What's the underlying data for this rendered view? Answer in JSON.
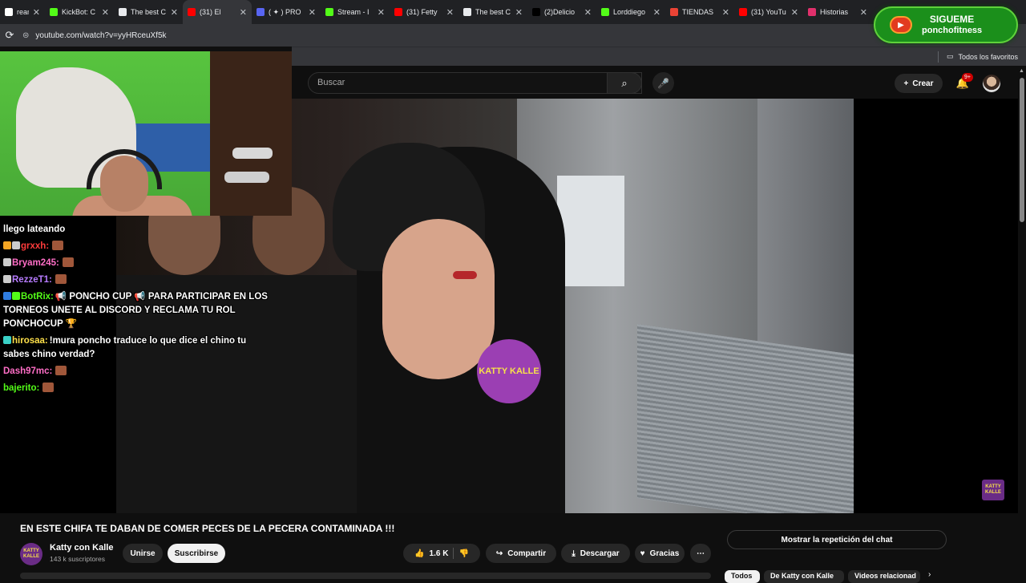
{
  "browser": {
    "tabs": [
      {
        "label": "ream - I",
        "color": "#ffffff",
        "active": false
      },
      {
        "label": "KickBot: C",
        "color": "#53fc18",
        "active": false
      },
      {
        "label": "The best C",
        "color": "#e8eaed",
        "active": false
      },
      {
        "label": "(31) El",
        "color": "#ff0000",
        "active": true
      },
      {
        "label": "( ✦ ) PRO",
        "color": "#5865f2",
        "active": false
      },
      {
        "label": "Stream - I",
        "color": "#53fc18",
        "active": false
      },
      {
        "label": "(31) Fetty",
        "color": "#ff0000",
        "active": false
      },
      {
        "label": "The best C",
        "color": "#e8eaed",
        "active": false
      },
      {
        "label": "(2)Delicio",
        "color": "#000000",
        "active": false
      },
      {
        "label": "Lorddiego",
        "color": "#53fc18",
        "active": false
      },
      {
        "label": "TIENDAS",
        "color": "#ea4335",
        "active": false
      },
      {
        "label": "(31) YouTu",
        "color": "#ff0000",
        "active": false
      },
      {
        "label": "Historias",
        "color": "#e1306c",
        "active": false
      }
    ],
    "close_glyph": "✕",
    "url": "youtube.com/watch?v=yyHRceuXf5k",
    "bookmarks_label": "Todos los favoritos"
  },
  "overlay": {
    "sigueme_line1": "SIGUEME",
    "sigueme_line2": "ponchofitness"
  },
  "youtube": {
    "search_placeholder": "Buscar",
    "crear_label": "Crear",
    "notif_badge": "9+",
    "video_title": "EN ESTE CHIFA TE DABAN DE COMER PECES DE LA PECERA CONTAMINADA !!!",
    "channel_name": "Katty con Kalle",
    "channel_subs": "143 k suscriptores",
    "unirse_label": "Unirse",
    "subscribe_label": "Suscribirse",
    "likes": "1.6 K",
    "share_label": "Compartir",
    "download_label": "Descargar",
    "thanks_label": "Gracias",
    "chat_replay_label": "Mostrar la repetición del chat",
    "chips": [
      "Todos",
      "De Katty con Kalle",
      "Videos relacionad"
    ],
    "logo_text": "KATTY KALLE",
    "mic_text": "KATTY KALLE"
  },
  "chat": [
    {
      "user": "",
      "user_color": "#ffffff",
      "text": "llego lateando",
      "badge_colors": []
    },
    {
      "user": "grxxh:",
      "user_color": "#ff3b3b",
      "text": "",
      "badge_colors": [
        "#f5a623",
        "#cccccc"
      ]
    },
    {
      "user": "Bryam245:",
      "user_color": "#ff6ec7",
      "text": "",
      "badge_colors": [
        "#cccccc"
      ]
    },
    {
      "user": "RezzeT1:",
      "user_color": "#b77cff",
      "text": "",
      "badge_colors": [
        "#cccccc"
      ]
    },
    {
      "user": "BotRix:",
      "user_color": "#53fc18",
      "text": "📢 PONCHO CUP 📢 PARA PARTICIPAR EN LOS TORNEOS UNETE AL DISCORD Y RECLAMA TU ROL PONCHOCUP 🏆",
      "badge_colors": [
        "#2f7de1",
        "#53fc18"
      ]
    },
    {
      "user": "hirosaa:",
      "user_color": "#ffe14a",
      "text": "!mura poncho traduce lo que dice el chino tu sabes chino verdad?",
      "badge_colors": [
        "#3ad1c7"
      ]
    },
    {
      "user": "Dash97mc:",
      "user_color": "#ff6ec7",
      "text": "",
      "badge_colors": []
    },
    {
      "user": "bajerito:",
      "user_color": "#53fc18",
      "text": "",
      "badge_colors": []
    }
  ],
  "icons": {
    "reload": "⟳",
    "search": "⌕",
    "mic": "🎤",
    "plus": "+",
    "bell": "🔔",
    "like": "👍",
    "dislike": "👎",
    "share": "↪",
    "download": "⤓",
    "thanks": "♥",
    "more": "⋯",
    "next": "›",
    "folder": "▭",
    "site": "⊜"
  }
}
